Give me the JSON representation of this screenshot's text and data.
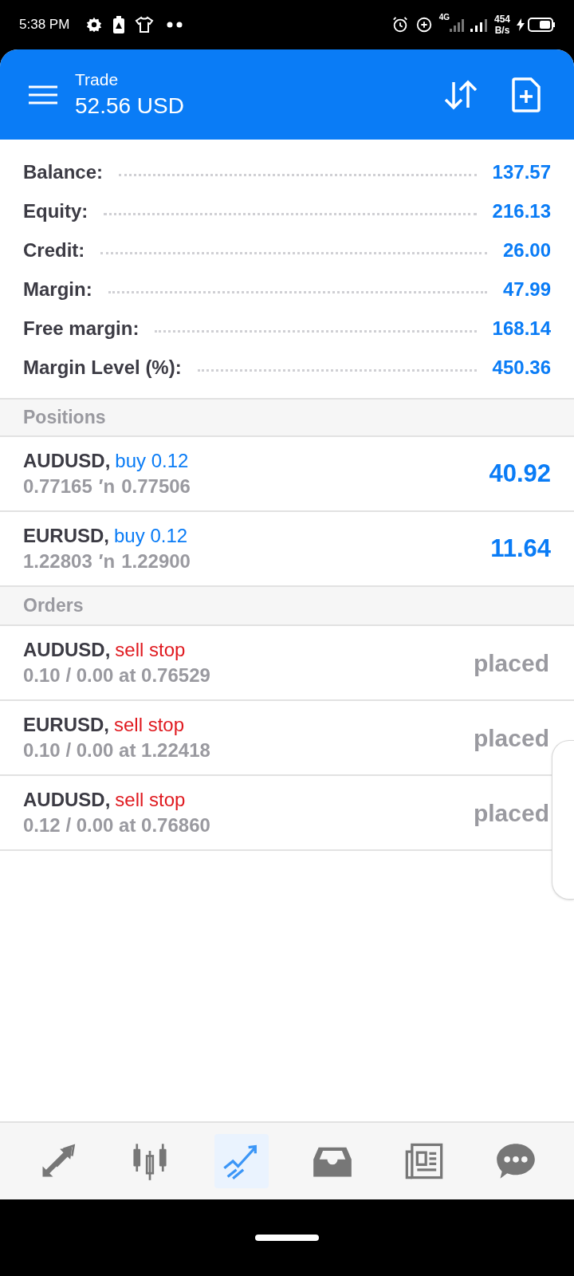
{
  "status_bar": {
    "time": "5:38 PM",
    "network": "4G",
    "speed": "454",
    "speed_unit": "B/s"
  },
  "header": {
    "title": "Trade",
    "amount": "52.56 USD"
  },
  "account": [
    {
      "label": "Balance:",
      "value": "137.57"
    },
    {
      "label": "Equity:",
      "value": "216.13"
    },
    {
      "label": "Credit:",
      "value": "26.00"
    },
    {
      "label": "Margin:",
      "value": "47.99"
    },
    {
      "label": "Free margin:",
      "value": "168.14"
    },
    {
      "label": "Margin Level (%):",
      "value": "450.36"
    }
  ],
  "positions": {
    "title": "Positions",
    "rows": [
      {
        "symbol": "AUDUSD,",
        "type": "buy 0.12",
        "kind": "buy",
        "open": "0.77165",
        "arrow": "′n",
        "current": "0.77506",
        "profit": "40.92"
      },
      {
        "symbol": "EURUSD,",
        "type": "buy 0.12",
        "kind": "buy",
        "open": "1.22803",
        "arrow": "′n",
        "current": "1.22900",
        "profit": "11.64"
      }
    ]
  },
  "orders": {
    "title": "Orders",
    "rows": [
      {
        "symbol": "AUDUSD,",
        "type": "sell stop",
        "kind": "sell",
        "detail": "0.10 / 0.00 at 0.76529",
        "state": "placed"
      },
      {
        "symbol": "EURUSD,",
        "type": "sell stop",
        "kind": "sell",
        "detail": "0.10 / 0.00 at 1.22418",
        "state": "placed"
      },
      {
        "symbol": "AUDUSD,",
        "type": "sell stop",
        "kind": "sell",
        "detail": "0.12 / 0.00 at 0.76860",
        "state": "placed"
      }
    ]
  },
  "nav": [
    {
      "kind": "arrows",
      "selected": false
    },
    {
      "kind": "candles",
      "selected": false
    },
    {
      "kind": "trend",
      "selected": true
    },
    {
      "kind": "inbox",
      "selected": false
    },
    {
      "kind": "news",
      "selected": false
    },
    {
      "kind": "chat",
      "selected": false
    }
  ]
}
